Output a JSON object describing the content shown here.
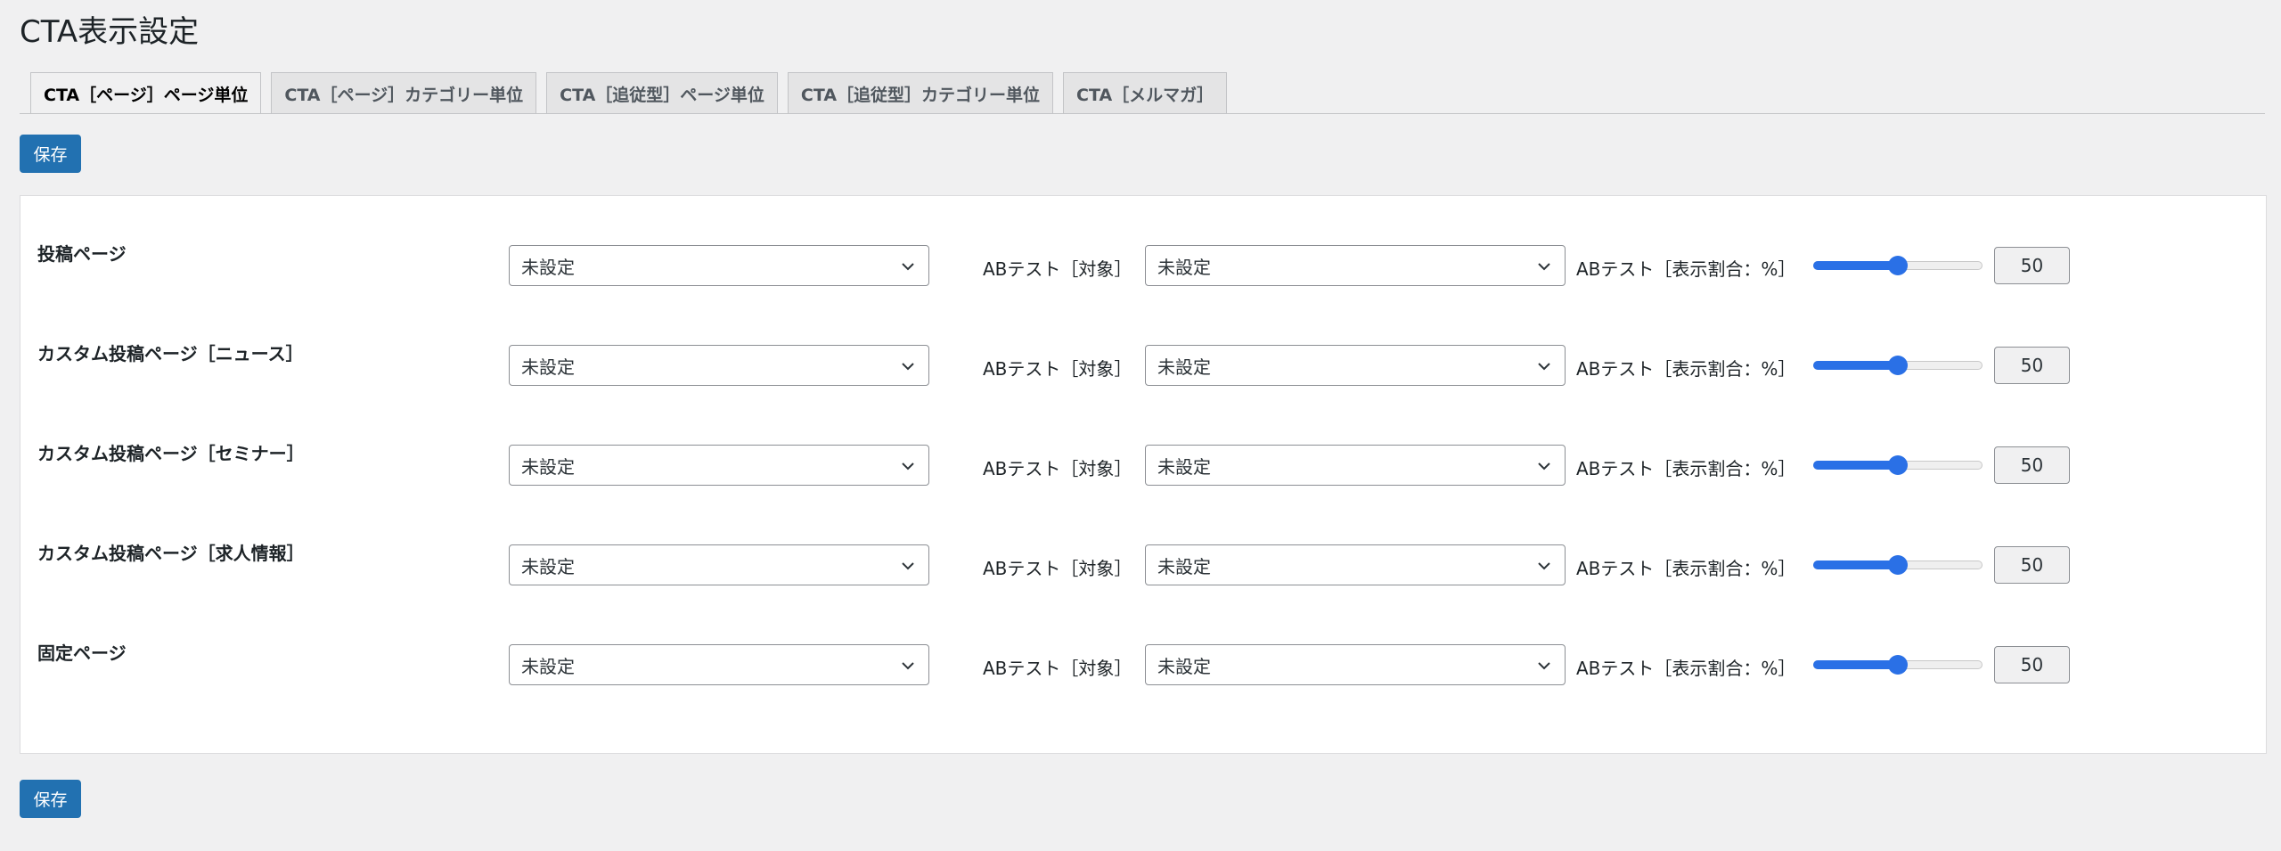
{
  "page": {
    "title": "CTA表示設定"
  },
  "tabs": [
    {
      "label": "CTA［ページ］ページ単位",
      "active": true
    },
    {
      "label": "CTA［ページ］カテゴリー単位",
      "active": false
    },
    {
      "label": "CTA［追従型］ページ単位",
      "active": false
    },
    {
      "label": "CTA［追従型］カテゴリー単位",
      "active": false
    },
    {
      "label": "CTA［メルマガ］",
      "active": false
    }
  ],
  "buttons": {
    "save_label": "保存"
  },
  "ab": {
    "target_label": "ABテスト［対象］",
    "ratio_label": "ABテスト［表示割合：%］"
  },
  "rows": [
    {
      "label": "投稿ページ",
      "cta": "未設定",
      "ab_target": "未設定",
      "ratio": 50
    },
    {
      "label": "カスタム投稿ページ［ニュース］",
      "cta": "未設定",
      "ab_target": "未設定",
      "ratio": 50
    },
    {
      "label": "カスタム投稿ページ［セミナー］",
      "cta": "未設定",
      "ab_target": "未設定",
      "ratio": 50
    },
    {
      "label": "カスタム投稿ページ［求人情報］",
      "cta": "未設定",
      "ab_target": "未設定",
      "ratio": 50
    },
    {
      "label": "固定ページ",
      "cta": "未設定",
      "ab_target": "未設定",
      "ratio": 50
    }
  ],
  "colors": {
    "primary": "#2271b1",
    "slider": "#2a70e6",
    "background": "#f0f0f1"
  },
  "icons": {
    "select_arrow": "chevron-down-icon"
  }
}
